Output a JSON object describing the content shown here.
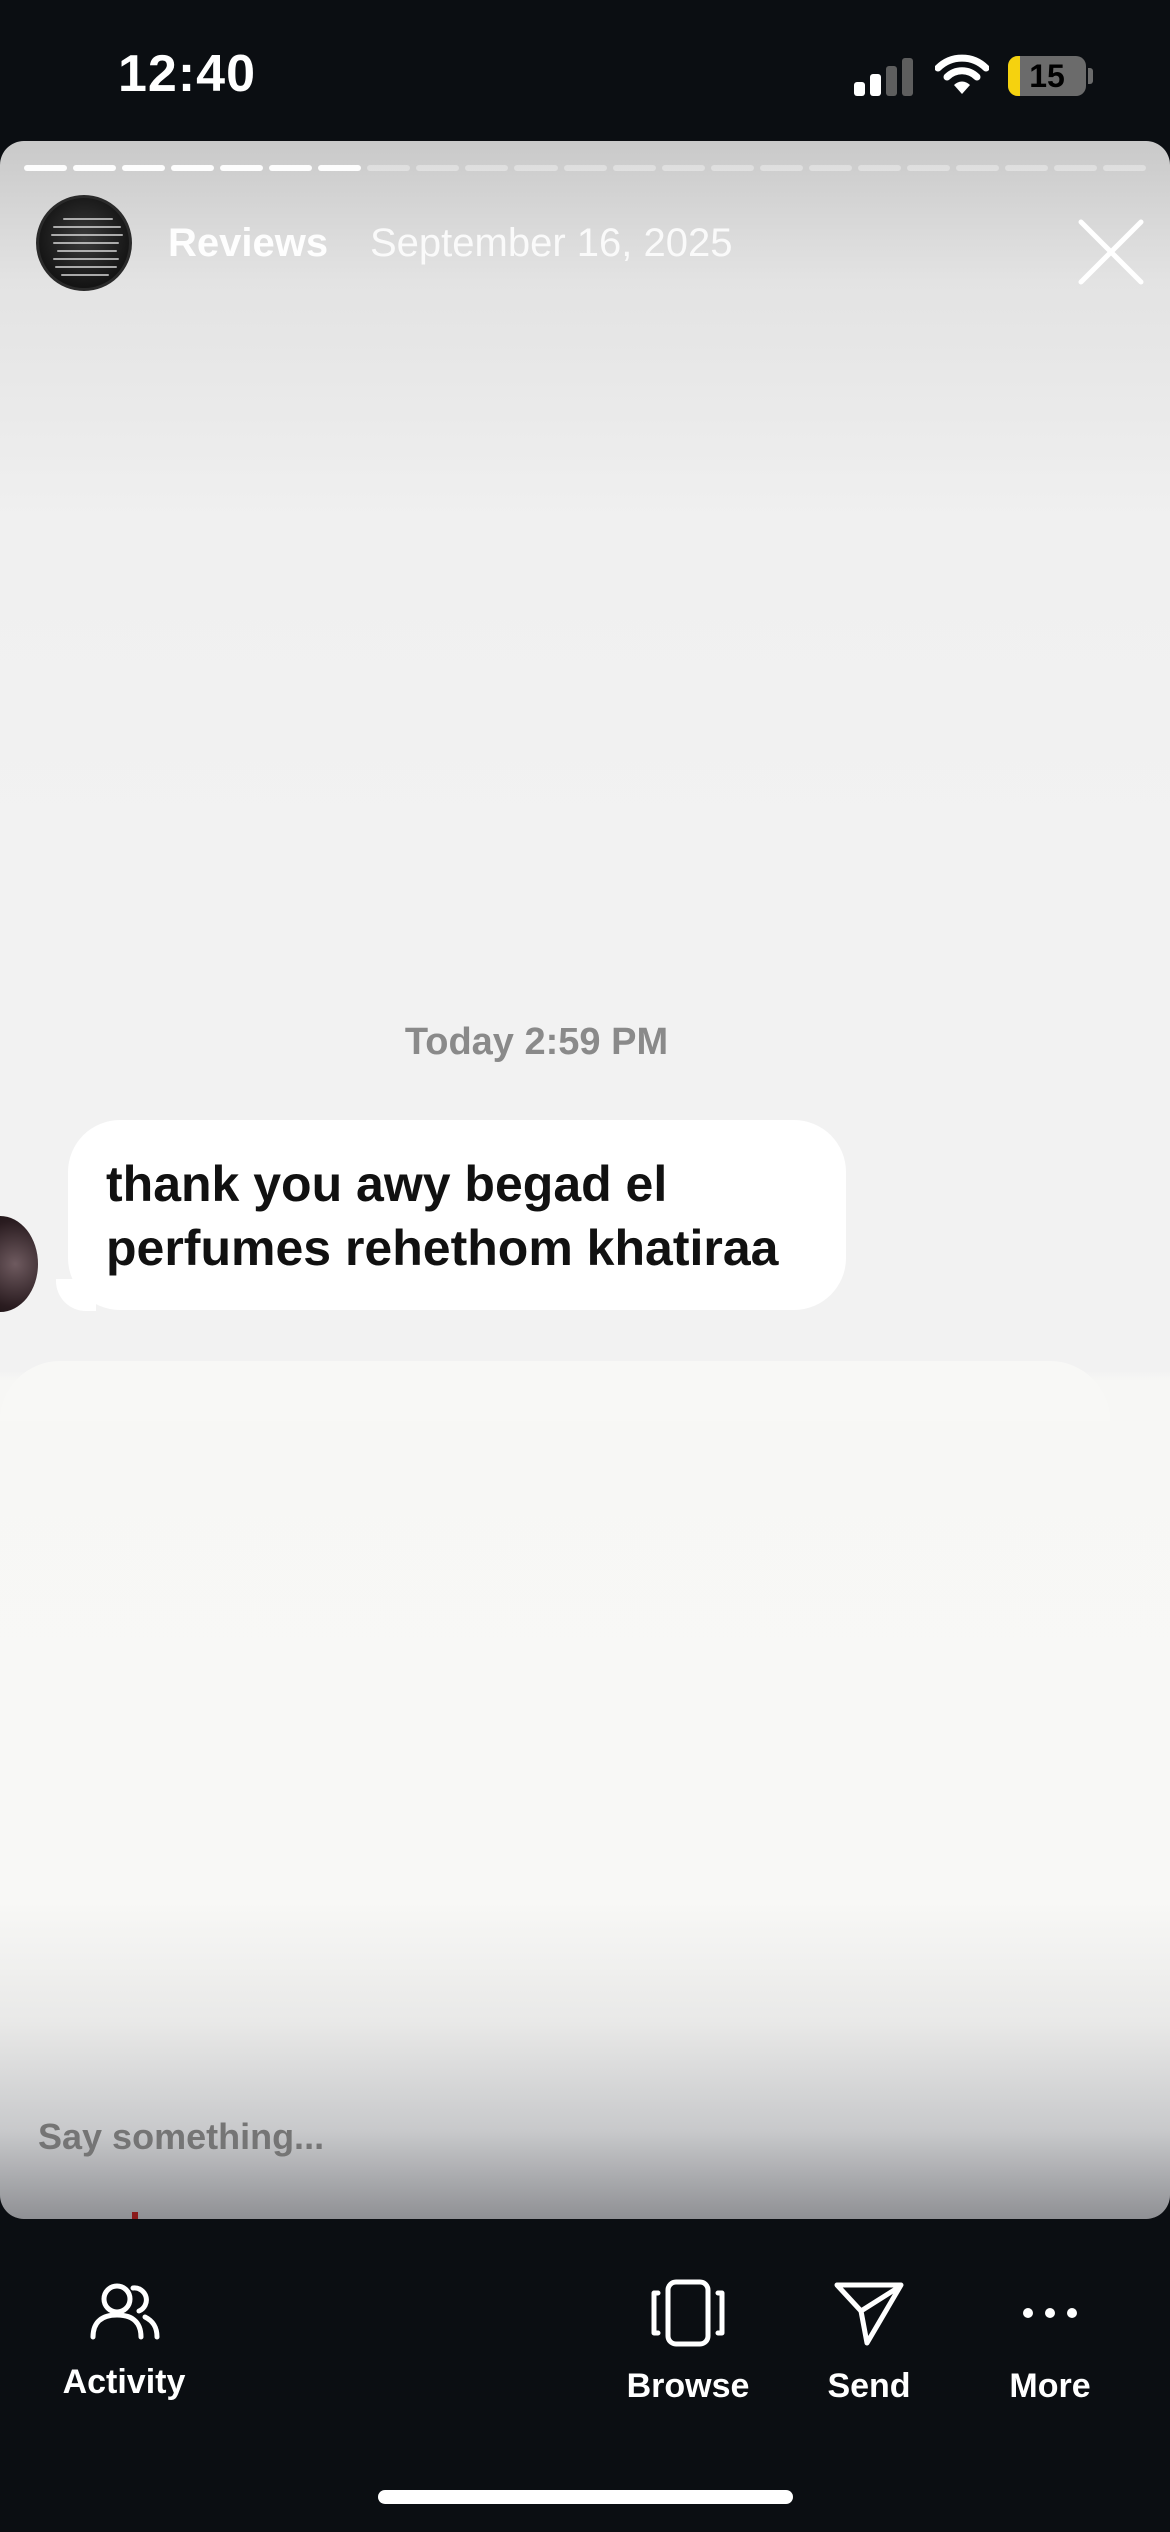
{
  "status_bar": {
    "time": "12:40",
    "battery_percent": "15",
    "signal_icon": "cellular-signal-icon",
    "wifi_icon": "wifi-icon",
    "battery_icon": "battery-icon"
  },
  "story": {
    "title": "Reviews",
    "date": "September 16, 2025",
    "progress": {
      "total_segments": 23,
      "completed_segments": 7
    },
    "close_icon": "close-icon"
  },
  "message": {
    "timestamp": "Today 2:59 PM",
    "text_line_1": "thank you awy begad el",
    "text_line_2": "perfumes rehethom khatiraa"
  },
  "reply": {
    "placeholder": "Say something..."
  },
  "bottom_bar": {
    "activity_label": "Activity",
    "browse_label": "Browse",
    "send_label": "Send",
    "more_label": "More",
    "activity_icon": "people-icon",
    "browse_icon": "browse-icon",
    "send_icon": "paper-plane-icon",
    "more_icon": "ellipsis-icon"
  },
  "colors": {
    "background": "#0b0e12",
    "battery_low": "#f5d20f",
    "bubble": "#ffffff"
  }
}
